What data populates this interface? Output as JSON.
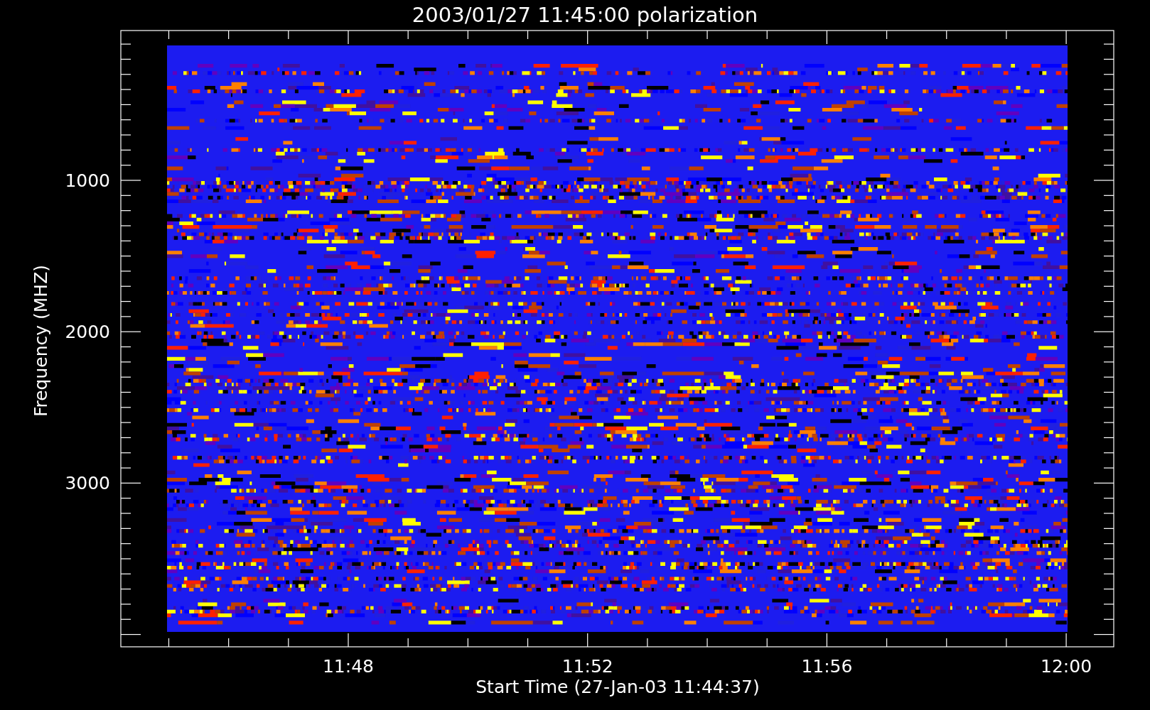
{
  "title": "2003/01/27 11:45:00 polarization",
  "y_axis": {
    "label": "Frequency (MHZ)",
    "tick_labels": [
      "1000",
      "2000",
      "3000"
    ]
  },
  "x_axis": {
    "label": "Start Time (27-Jan-03 11:44:37)",
    "tick_labels": [
      "11:48",
      "11:52",
      "11:56",
      "12:00"
    ]
  }
}
